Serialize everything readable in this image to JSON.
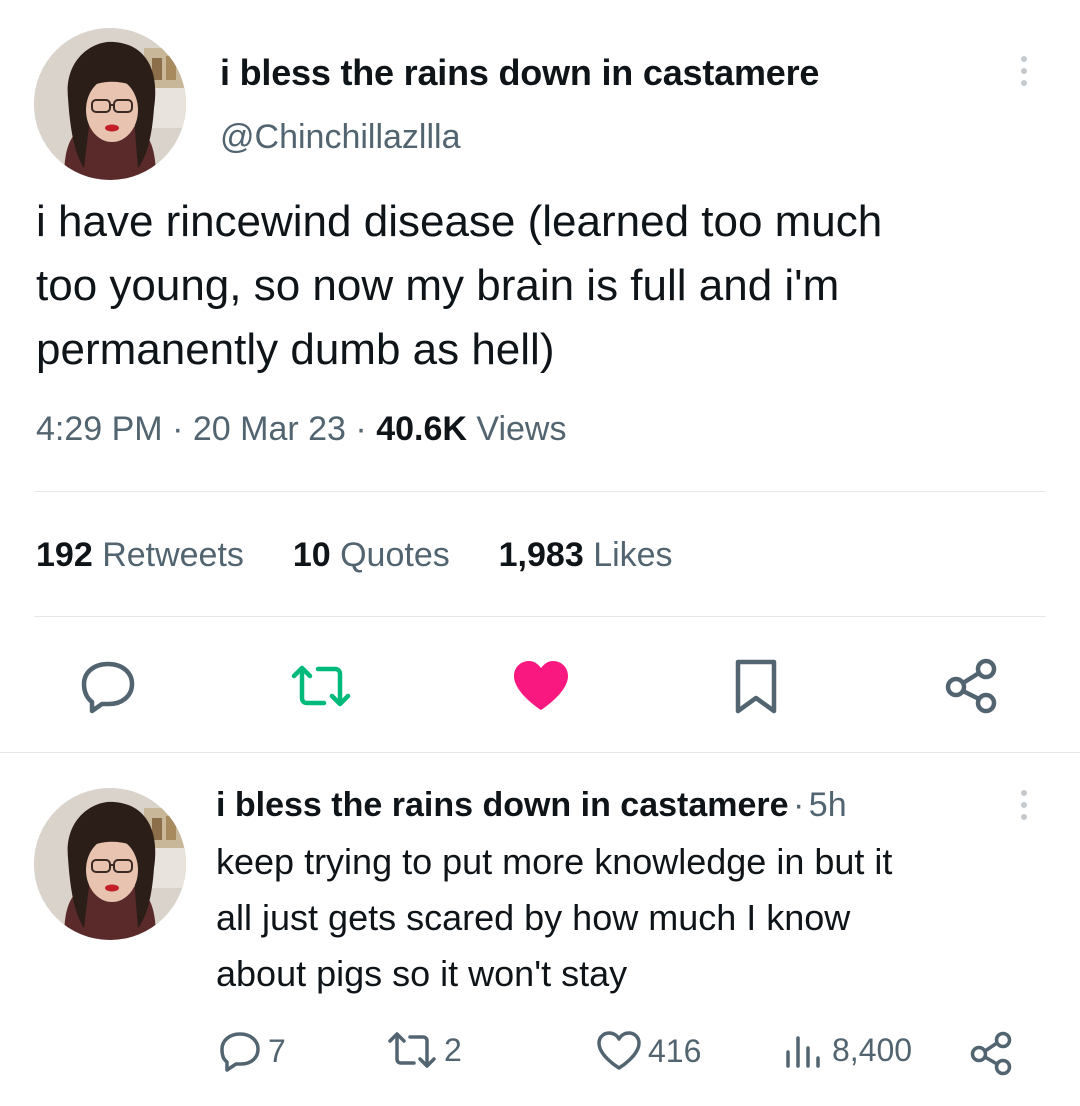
{
  "tweet": {
    "display_name": "i bless the rains down in castamere",
    "handle": "@Chinchillazllla",
    "text_lines": [
      "i have rincewind disease (learned too much",
      "too young, so now my brain is full and i'm",
      "permanently dumb as hell)"
    ],
    "time": "4:29 PM",
    "date": "20 Mar 23",
    "separator": "·",
    "views_count": "40.6K",
    "views_label": "Views",
    "stats": {
      "retweets_count": "192",
      "retweets_label": "Retweets",
      "quotes_count": "10",
      "quotes_label": "Quotes",
      "likes_count": "1,983",
      "likes_label": "Likes"
    },
    "icons": [
      "reply-icon",
      "retweet-icon",
      "like-icon",
      "bookmark-icon",
      "share-icon",
      "more-icon"
    ]
  },
  "reply": {
    "display_name": "i bless the rains down in castamere",
    "separator": "·",
    "time": "5h",
    "text_lines": [
      "keep trying to put more knowledge in but it",
      "all just gets scared by how much I know",
      "about pigs so it won't stay"
    ],
    "actions": {
      "replies": "7",
      "retweets": "2",
      "likes": "416",
      "views": "8,400"
    }
  },
  "colors": {
    "text": "#0f1419",
    "secondary": "#536471",
    "retweet_green": "#00ba7c",
    "like_pink": "#f91880",
    "divider": "#e6e9eb"
  }
}
